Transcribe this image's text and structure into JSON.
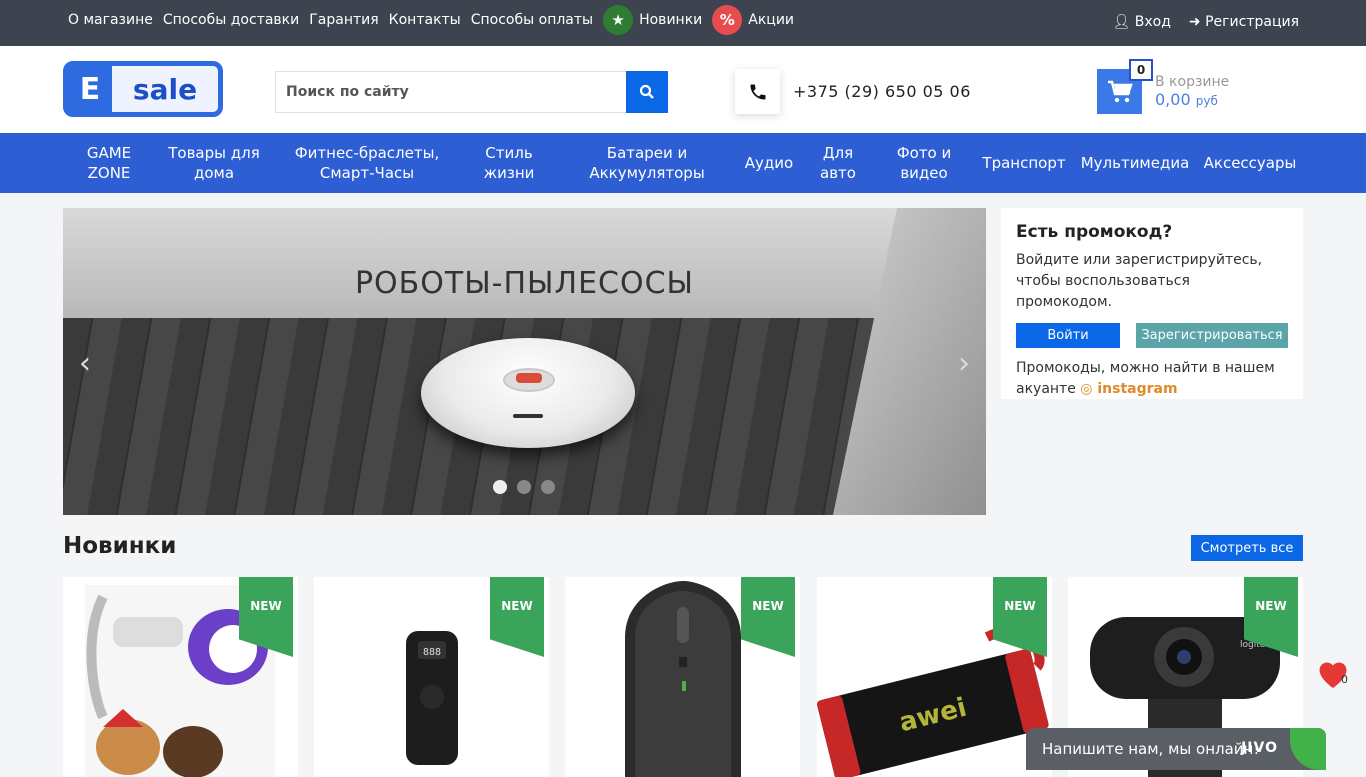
{
  "topbar": {
    "links": [
      "О магазине",
      "Способы доставки",
      "Гарантия",
      "Контакты",
      "Способы оплаты"
    ],
    "new_label": "Новинки",
    "sale_label": "Акции",
    "sale_icon_text": "%",
    "login": "Вход",
    "register": "Регистрация",
    "colors": {
      "bg": "#3d4450",
      "new_icon": "#2e7d32",
      "sale_icon": "#e74c4c"
    }
  },
  "header": {
    "logo_letter": "E",
    "logo_text": "sale",
    "search_placeholder": "Поиск по сайту",
    "phone": "+375 (29) 650 05 06",
    "cart": {
      "count": "0",
      "label": "В корзине",
      "sum": "0,00",
      "currency": "руб"
    }
  },
  "nav": {
    "items": [
      "GAME ZONE",
      "Товары для дома",
      "Фитнес-браслеты, Смарт-Часы",
      "Стиль жизни",
      "Батареи и Аккумуляторы",
      "Аудио",
      "Для авто",
      "Фото и видео",
      "Транспорт",
      "Мультимедиа",
      "Аксессуары"
    ],
    "color": "#2d5ed4"
  },
  "slider": {
    "title": "РОБОТЫ-ПЫЛЕСОСЫ",
    "prev": "‹",
    "next": "›",
    "slide_count": 3,
    "active_slide": 1
  },
  "promo": {
    "title": "Есть промокод?",
    "text": "Войдите или зарегистрируйтесь, чтобы воспользоваться промокодом.",
    "login_button": "Войти",
    "register_button": "Зарегистрироваться",
    "note": "Промокоды, можно найти в нашем акуанте",
    "instagram": "instagram"
  },
  "new_section": {
    "title": "Новинки",
    "see_all": "Смотреть все",
    "badge": "NEW",
    "products": [
      "pet-grooming-vacuum",
      "smart-device",
      "wireless-mouse",
      "awei-speaker",
      "logitech-webcam"
    ]
  },
  "favorites": {
    "count": "0"
  },
  "chat": {
    "text": "Напишите нам, мы онлайн!",
    "brand": "JIVO"
  }
}
